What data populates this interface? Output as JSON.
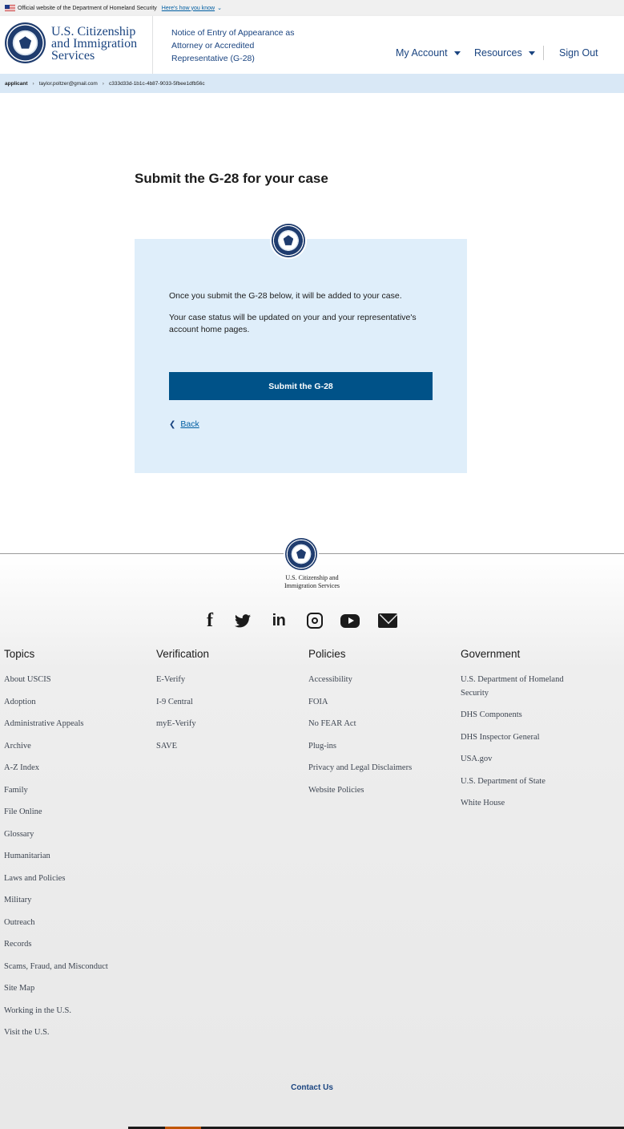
{
  "gov_banner": {
    "text": "Official website of the Department of Homeland Security",
    "link": "Here's how you know"
  },
  "header": {
    "brand_lines": [
      "U.S. Citizenship",
      "and Immigration",
      "Services"
    ],
    "form_title": "Notice of Entry of Appearance as Attorney or Accredited Representative (G-28)",
    "nav": {
      "my_account": "My Account",
      "resources": "Resources",
      "sign_out": "Sign Out"
    }
  },
  "breadcrumb": [
    "applicant",
    "taylor.poltzer@gmail.com",
    "c333d33d-1b1c-4b87-9033-5fbee1dfb56c"
  ],
  "main": {
    "title": "Submit the G-28 for your case",
    "text1": "Once you submit the G-28 below, it will be added to your case.",
    "text2": "Your case status will be updated on your and your representative's account home pages.",
    "submit_label": "Submit the G-28",
    "back_label": "Back"
  },
  "footer": {
    "brand_lines": [
      "U.S. Citizenship and",
      "Immigration Services"
    ],
    "social_icons": [
      "facebook-icon",
      "twitter-icon",
      "linkedin-icon",
      "instagram-icon",
      "youtube-icon",
      "email-icon"
    ],
    "columns": [
      {
        "heading": "Topics",
        "links": [
          "About USCIS",
          "Adoption",
          "Administrative Appeals",
          "Archive",
          "A-Z Index",
          "Family",
          "File Online",
          "Glossary",
          "Humanitarian",
          "Laws and Policies",
          "Military",
          "Outreach",
          "Records",
          "Scams, Fraud, and Misconduct",
          "Site Map",
          "Working in the U.S.",
          "Visit the U.S."
        ]
      },
      {
        "heading": "Verification",
        "links": [
          "E-Verify",
          "I-9 Central",
          "myE-Verify",
          "SAVE"
        ]
      },
      {
        "heading": "Policies",
        "links": [
          "Accessibility",
          "FOIA",
          "No FEAR Act",
          "Plug-ins",
          "Privacy and Legal Disclaimers",
          "Website Policies"
        ]
      },
      {
        "heading": "Government",
        "links": [
          "U.S. Department of Homeland Security",
          "DHS Components",
          "DHS Inspector General",
          "USA.gov",
          "U.S. Department of State",
          "White House"
        ]
      }
    ],
    "contact": "Contact Us"
  },
  "colors": {
    "primary": "#005288",
    "brand_text": "#1a4480",
    "card_bg": "#dfeefa",
    "breadcrumb_bg": "#d9e8f6"
  }
}
